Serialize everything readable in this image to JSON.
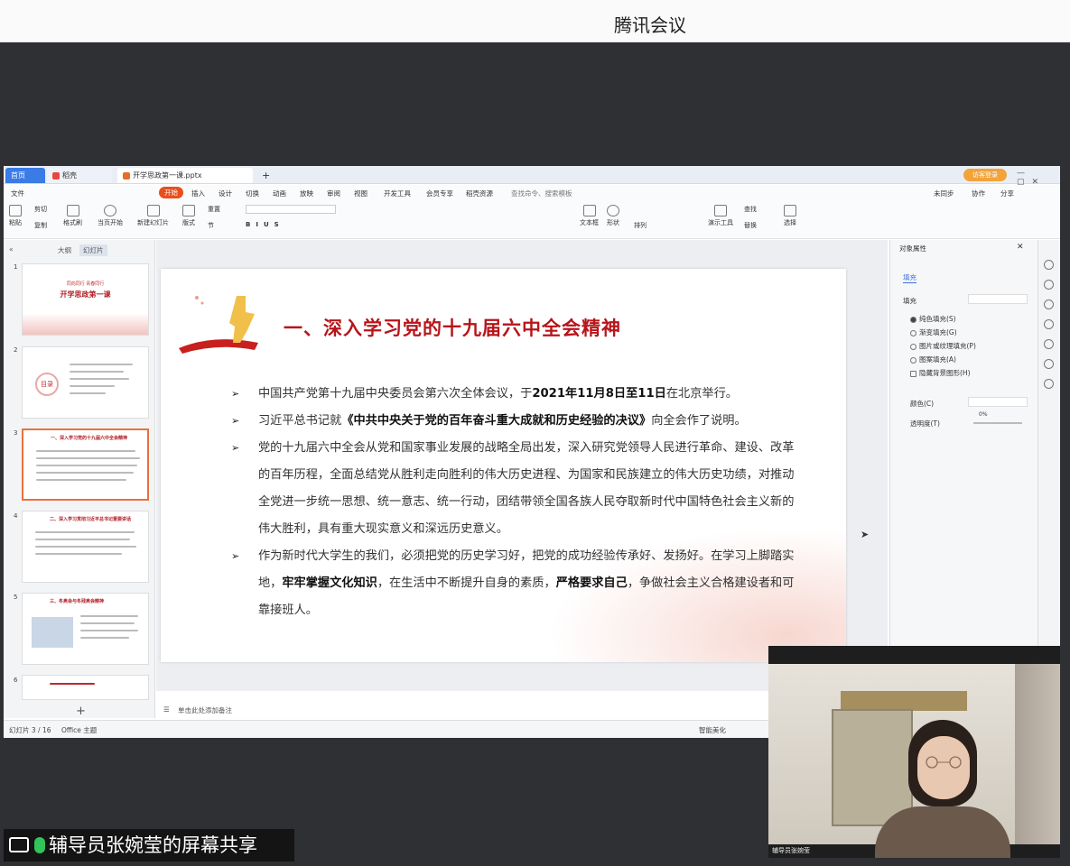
{
  "app": {
    "title": "腾讯会议"
  },
  "wps": {
    "tabs": {
      "home": "首页",
      "daoke": "稻壳",
      "doc": "开学思政第一课.pptx",
      "plus": "+"
    },
    "login": "访客登录",
    "menu": [
      "文件",
      "开始",
      "插入",
      "设计",
      "切换",
      "动画",
      "放映",
      "审阅",
      "视图",
      "开发工具",
      "会员专享",
      "稻壳资源"
    ],
    "search_placeholder": "查找命令、搜索模板",
    "menu_right": [
      "未同步",
      "协作",
      "分享"
    ],
    "ribbon": [
      "粘贴",
      "剪切",
      "复制",
      "格式刷",
      "当页开始",
      "新建幻灯片",
      "版式",
      "节",
      "重置",
      "文本框",
      "形状",
      "排列",
      "演示工具",
      "查找",
      "替换",
      "选择"
    ]
  },
  "left_panel": {
    "tab_outline": "大纲",
    "tab_slides": "幻灯片",
    "add": "+"
  },
  "thumbnails": [
    {
      "num": "1",
      "title": "开学思政第一课",
      "sub": "同向同行 青春同行"
    },
    {
      "num": "2",
      "title": "目录",
      "sub": ""
    },
    {
      "num": "3",
      "title": "一、深入学习党的十九届六中全会精神",
      "sub": ""
    },
    {
      "num": "4",
      "title": "二、深入学习贯彻习近平总书记重要讲话",
      "sub": ""
    },
    {
      "num": "5",
      "title": "三、冬奥会与冬残奥会精神",
      "sub": ""
    },
    {
      "num": "6",
      "title": "",
      "sub": ""
    }
  ],
  "slide": {
    "title": "一、深入学习党的十九届六中全会精神",
    "bullets": [
      {
        "a": "中国共产党第十九届中央委员会第六次全体会议，于",
        "b": "2021年11月8日至11日",
        "c": "在北京举行。"
      },
      {
        "a": "习近平总书记就",
        "b": "《中共中央关于党的百年奋斗重大成就和历史经验的决议》",
        "c": "向全会作了说明。"
      },
      {
        "a": "党的十九届六中全会从党和国家事业发展的战略全局出发，深入研究党领导人民进行革命、建设、改革的百年历程，全面总结党从胜利走向胜利的伟大历史进程、为国家和民族建立的伟大历史功绩，对推动全党进一步统一思想、统一意志、统一行动，团结带领全国各族人民夺取新时代中国特色社会主义新的伟大胜利，具有重大现实意义和深远历史意义。",
        "b": "",
        "c": ""
      },
      {
        "a": "作为新时代大学生的我们，必须把党的历史学习好，把党的成功经验传承好、发扬好。在学习上脚踏实地，",
        "b": "牢牢掌握文化知识",
        "c": "，在生活中不断提升自身的素质，",
        "d": "严格要求自己",
        "e": "，争做社会主义合格建设者和可靠接班人。"
      }
    ]
  },
  "notes": "单击此处添加备注",
  "properties": {
    "header": "对象属性",
    "fill_tab": "填充",
    "fill_section": "填充",
    "options": [
      "纯色填充(S)",
      "渐变填充(G)",
      "图片或纹理填充(P)",
      "图案填充(A)",
      "隐藏背景图形(H)"
    ],
    "color": "颜色(C)",
    "transparency": "透明度(T)",
    "transparency_value": "0%"
  },
  "status": {
    "slide": "幻灯片 3 / 16",
    "theme": "Office 主题",
    "smart": "智能美化"
  },
  "video": {
    "label": "辅导员张婉莹"
  },
  "presenter": {
    "text": "辅导员张婉莹的屏幕共享"
  }
}
